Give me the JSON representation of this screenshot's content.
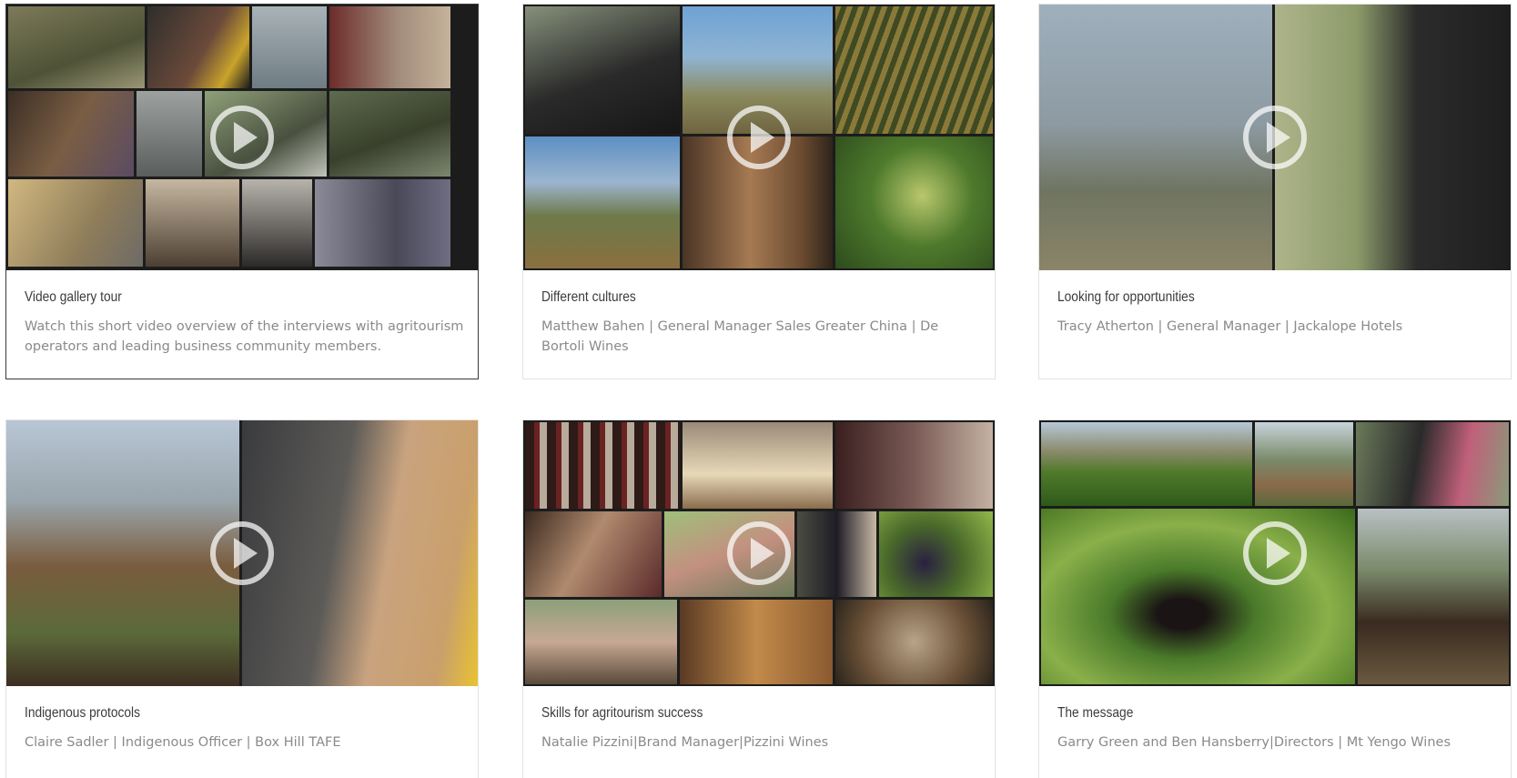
{
  "gallery": {
    "cards": [
      {
        "title": "Video gallery tour",
        "description": "Watch this short video overview of the interviews with agritourism operators and leading business community members."
      },
      {
        "title": "Different cultures",
        "description": "Matthew Bahen | General Manager Sales Greater China | De Bortoli Wines"
      },
      {
        "title": "Looking for opportunities",
        "description": "Tracy Atherton | General Manager | Jackalope Hotels"
      },
      {
        "title": "Indigenous protocols",
        "description": "Claire Sadler | Indigenous Officer | Box Hill TAFE"
      },
      {
        "title": "Skills for agritourism success",
        "description": "Natalie Pizzini|Brand Manager|Pizzini Wines"
      },
      {
        "title": "The message",
        "description": "Garry Green and Ben Hansberry|Directors | Mt Yengo Wines"
      }
    ],
    "play_icon": "play-circle-icon"
  },
  "colors": {
    "title": "#3b3b3b",
    "description": "#8a8a8a",
    "card_border": "#e2e2e2",
    "active_border": "#3a3a3a"
  }
}
